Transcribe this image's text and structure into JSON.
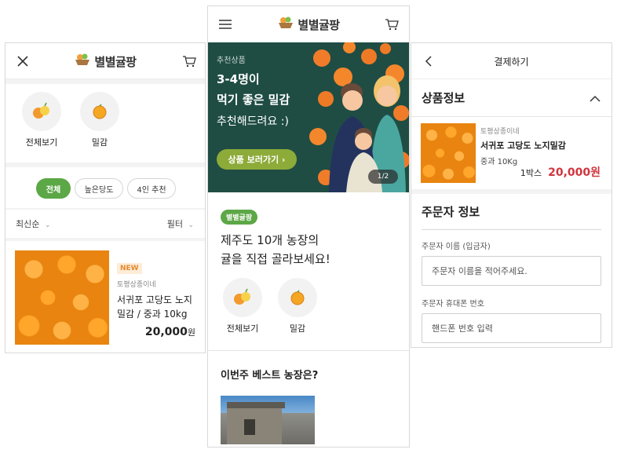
{
  "left": {
    "logo": "별별귤팡",
    "categories": [
      {
        "label": "전체보기",
        "icon": "mixed-citrus-icon"
      },
      {
        "label": "밀감",
        "icon": "tangerine-icon"
      }
    ],
    "chips": [
      "전체",
      "높은당도",
      "4인 추천"
    ],
    "sort_label": "최신순",
    "filter_label": "필터",
    "product": {
      "badge": "NEW",
      "seller": "토평상종이네",
      "name_line1": "서귀포 고당도 노지",
      "name_line2": "밀감 / 중과 10kg",
      "price": "20,000",
      "won": "원"
    }
  },
  "mid": {
    "logo": "별별귤팡",
    "banner": {
      "eyebrow": "추천상품",
      "line1": "3-4명이",
      "line2": "먹기 좋은 밀감",
      "line3": "추천해드려요 :)",
      "cta": "상품 보러가기 ›",
      "pager": "1/2"
    },
    "tag": "별별귤팡",
    "headline1": "제주도 10개 농장의",
    "headline2": "귤을 직접 골라보세요!",
    "categories": [
      {
        "label": "전체보기",
        "icon": "mixed-citrus-icon"
      },
      {
        "label": "밀감",
        "icon": "tangerine-icon"
      }
    ],
    "best_title": "이번주 베스트 농장은?"
  },
  "right": {
    "title": "결제하기",
    "product_section": "상품정보",
    "seller": "토평상종이네",
    "product_name": "서귀포 고당도 노지밀감",
    "option": "중과 10Kg",
    "qty": "1박스",
    "price": "20,000원",
    "orderer_section": "주문자 정보",
    "name_label": "주문자 이름 (입금자)",
    "name_placeholder": "주문자 이름을 적어주세요.",
    "phone_label": "주문자 휴대폰 번호",
    "phone_placeholder": "핸드폰 번호 입력"
  },
  "colors": {
    "accent_green": "#5ca746",
    "price_red": "#d0353f",
    "banner_bg": "#1f4d44",
    "orange": "#f0922e"
  }
}
